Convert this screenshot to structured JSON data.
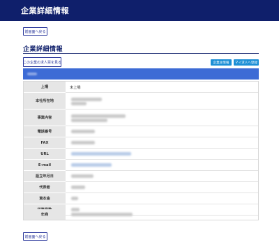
{
  "header": {
    "title": "企業詳細情報"
  },
  "top_back_label": "前画面へ戻る",
  "bottom_back_label": "前画面へ戻る",
  "section_title": "企業詳細情報",
  "job_listing_button": "この企業の求人票を見る",
  "action_buttons": {
    "company_info": "企業主情報",
    "add_to_list": "マイ求人へ登録"
  },
  "details": [
    {
      "label": "上場",
      "value": "未上場"
    },
    {
      "label": "本社所在地",
      "value": ""
    },
    {
      "label": "事業内容",
      "value": ""
    },
    {
      "label": "電話番号",
      "value": ""
    },
    {
      "label": "FAX",
      "value": ""
    },
    {
      "label": "URL",
      "value": ""
    },
    {
      "label": "E-mail",
      "value": ""
    },
    {
      "label": "設立年月日",
      "value": ""
    },
    {
      "label": "代表者",
      "value": ""
    },
    {
      "label": "資本金",
      "value": ""
    },
    {
      "label": "従業員数",
      "value": ""
    },
    {
      "label": "年商",
      "value": ""
    }
  ]
}
